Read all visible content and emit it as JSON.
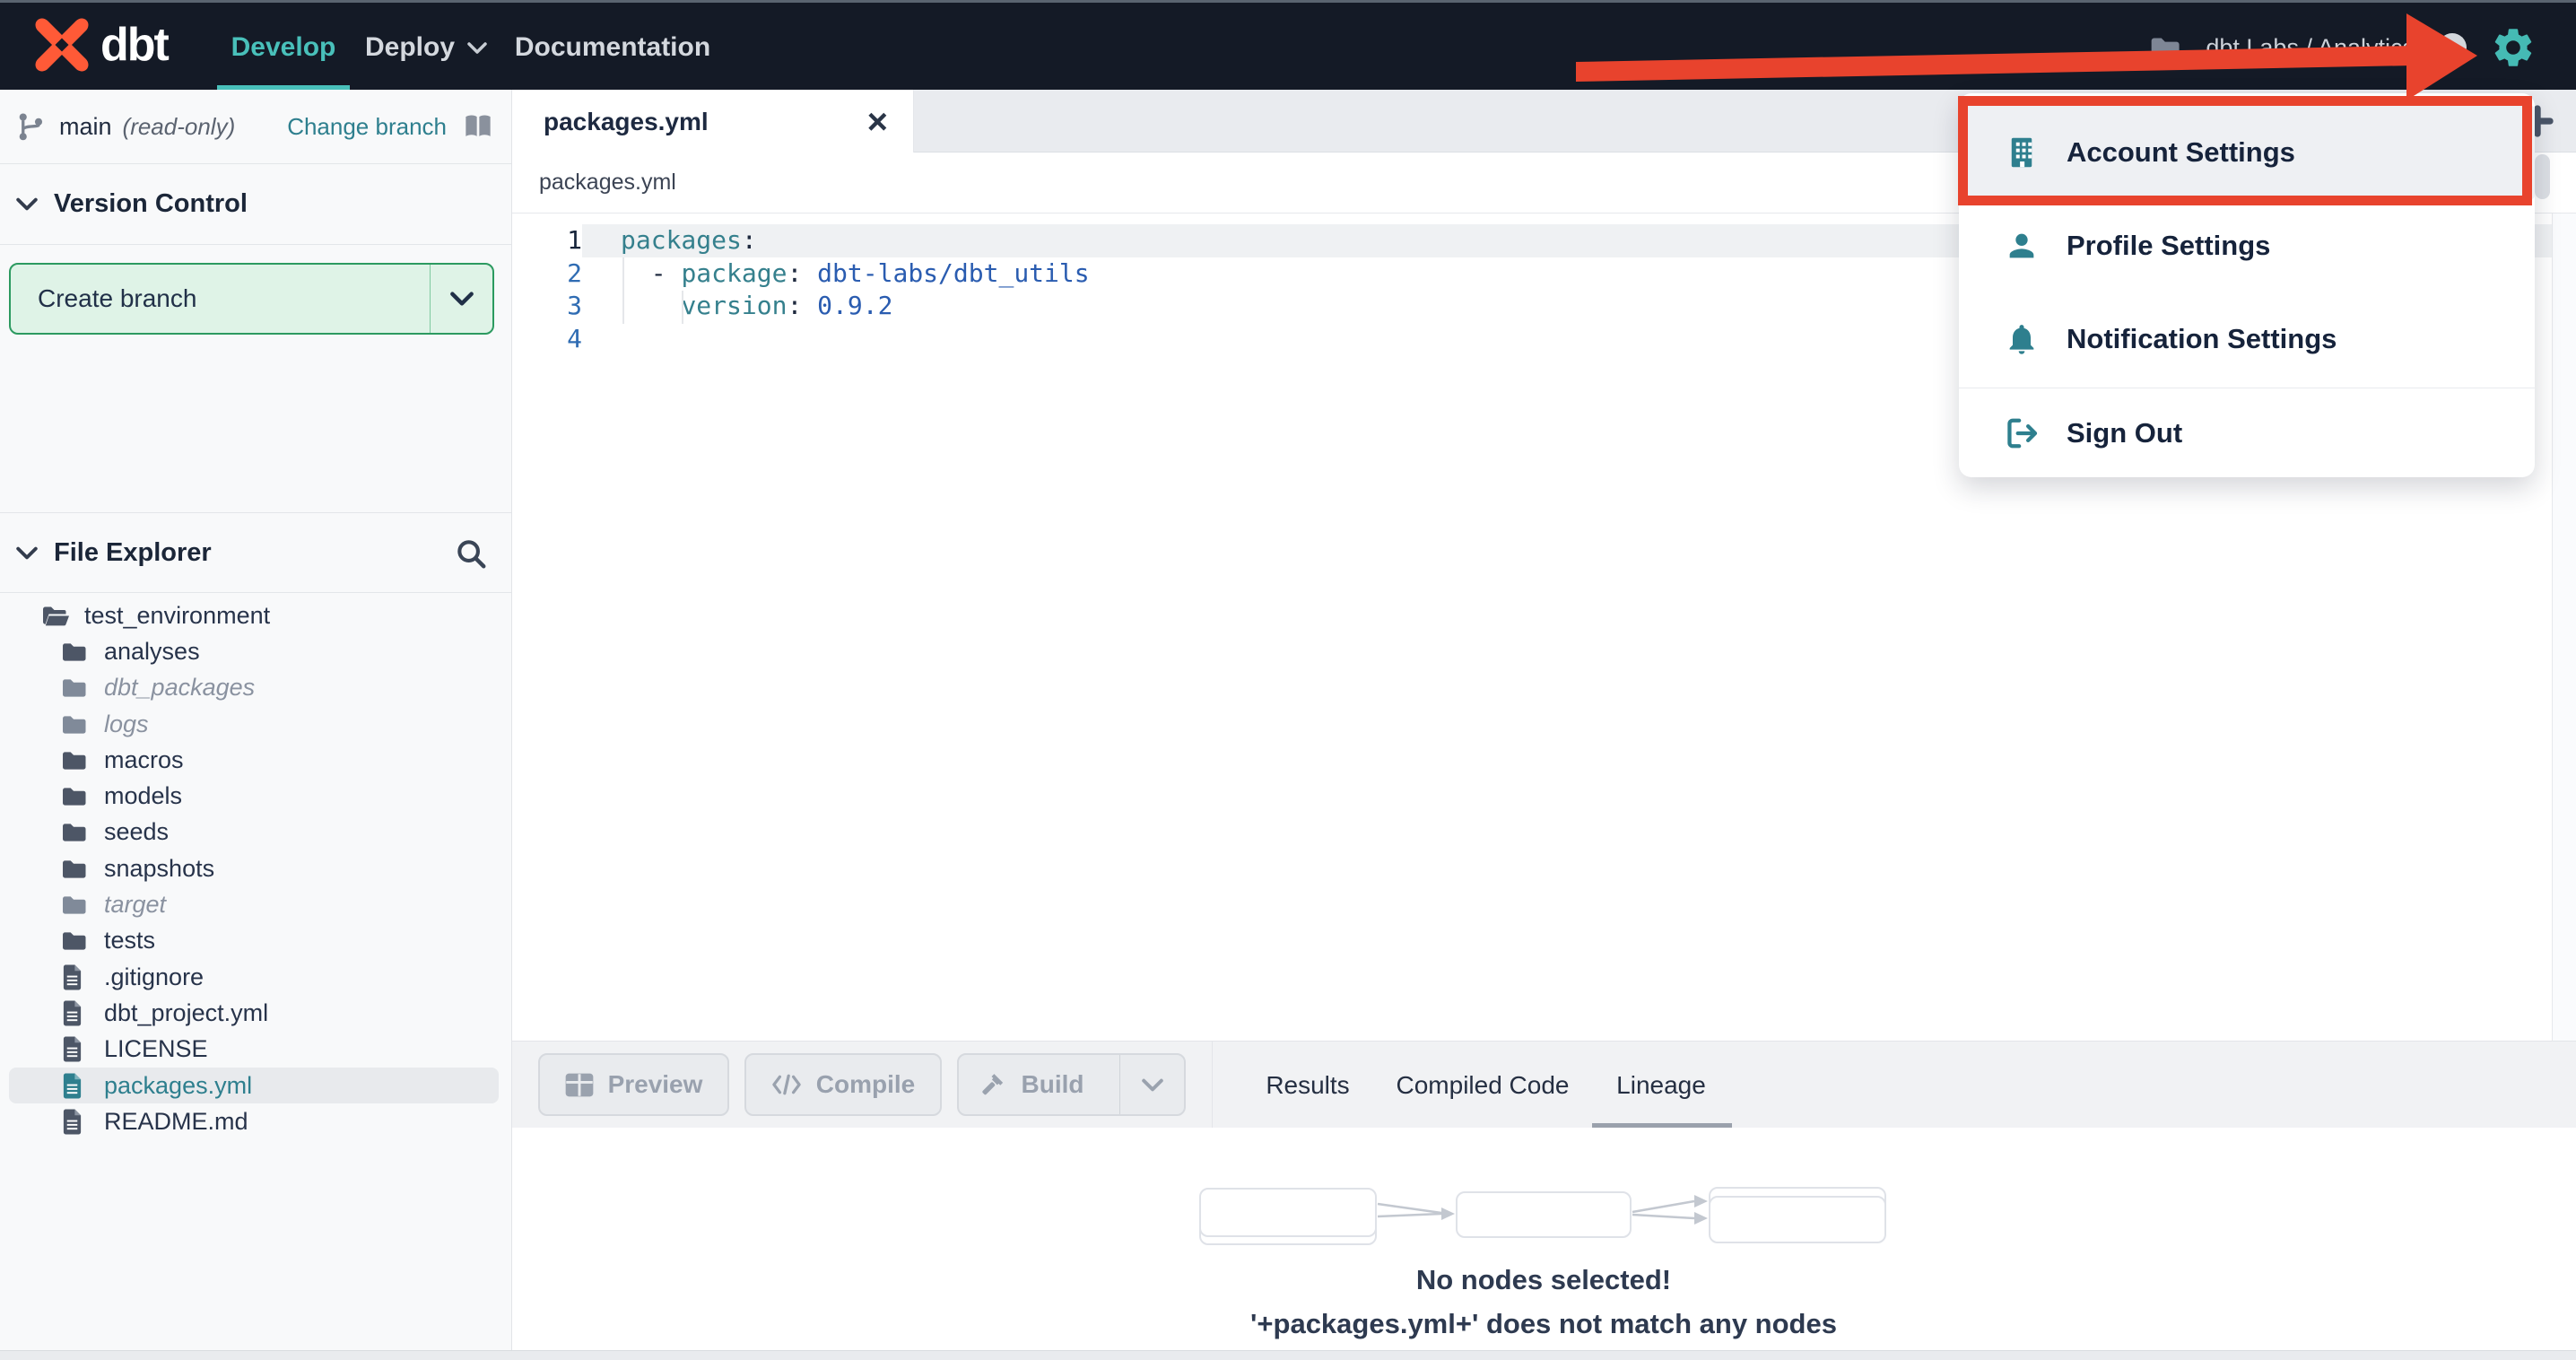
{
  "navbar": {
    "logo_text": "dbt",
    "develop": "Develop",
    "deploy": "Deploy",
    "documentation": "Documentation",
    "account_context": "dbt Labs / Analytics"
  },
  "account_menu": {
    "items": [
      {
        "label": "Account Settings",
        "icon": "building-icon",
        "highlighted": true
      },
      {
        "label": "Profile Settings",
        "icon": "person-icon"
      },
      {
        "label": "Notification Settings",
        "icon": "bell-icon"
      },
      {
        "label": "Sign Out",
        "icon": "sign-out-icon"
      }
    ]
  },
  "annotations": {
    "arrow_color": "#e8432d",
    "highlight_box_color": "#e8432d",
    "highlight_target": "Account Settings"
  },
  "sidebar": {
    "branch": {
      "name": "main",
      "mode": "(read-only)",
      "change_branch": "Change branch"
    },
    "version_control_title": "Version Control",
    "create_branch": "Create branch",
    "file_explorer_title": "File Explorer",
    "files": [
      {
        "name": "test_environment",
        "type": "folder-open",
        "depth": 0
      },
      {
        "name": "analyses",
        "type": "folder",
        "depth": 1
      },
      {
        "name": "dbt_packages",
        "type": "folder",
        "depth": 1,
        "muted": true
      },
      {
        "name": "logs",
        "type": "folder",
        "depth": 1,
        "muted": true
      },
      {
        "name": "macros",
        "type": "folder",
        "depth": 1
      },
      {
        "name": "models",
        "type": "folder",
        "depth": 1
      },
      {
        "name": "seeds",
        "type": "folder",
        "depth": 1
      },
      {
        "name": "snapshots",
        "type": "folder",
        "depth": 1
      },
      {
        "name": "target",
        "type": "folder",
        "depth": 1,
        "muted": true
      },
      {
        "name": "tests",
        "type": "folder",
        "depth": 1
      },
      {
        "name": ".gitignore",
        "type": "file",
        "depth": 1
      },
      {
        "name": "dbt_project.yml",
        "type": "file",
        "depth": 1
      },
      {
        "name": "LICENSE",
        "type": "file",
        "depth": 1
      },
      {
        "name": "packages.yml",
        "type": "file",
        "depth": 1,
        "selected": true
      },
      {
        "name": "README.md",
        "type": "file",
        "depth": 1
      }
    ]
  },
  "editor": {
    "tab_title": "packages.yml",
    "breadcrumb": "packages.yml",
    "line_numbers": [
      "1",
      "2",
      "3",
      "4"
    ],
    "code": {
      "line1": {
        "key": "packages",
        "colon": ":"
      },
      "line2": {
        "indent": "  ",
        "dash": "- ",
        "key": "package",
        "colon": ": ",
        "value": "dbt-labs/dbt_utils"
      },
      "line3": {
        "indent": "    ",
        "key": "version",
        "colon": ": ",
        "value": "0.9.2"
      }
    }
  },
  "toolbar": {
    "preview": "Preview",
    "compile": "Compile",
    "build": "Build",
    "tabs": [
      "Results",
      "Compiled Code",
      "Lineage"
    ],
    "active_tab": "Lineage"
  },
  "lineage": {
    "empty_title": "No nodes selected!",
    "empty_detail": "'+packages.yml+' does not match any nodes"
  },
  "colors": {
    "navbar_bg": "#141a26",
    "accent_teal": "#49c0ba",
    "icon_teal": "#2e7f8e",
    "annotation_red": "#e8432d",
    "code_key_teal": "#35808d",
    "code_value_blue": "#2a5cb0",
    "create_branch_green": "#2c9a60"
  }
}
